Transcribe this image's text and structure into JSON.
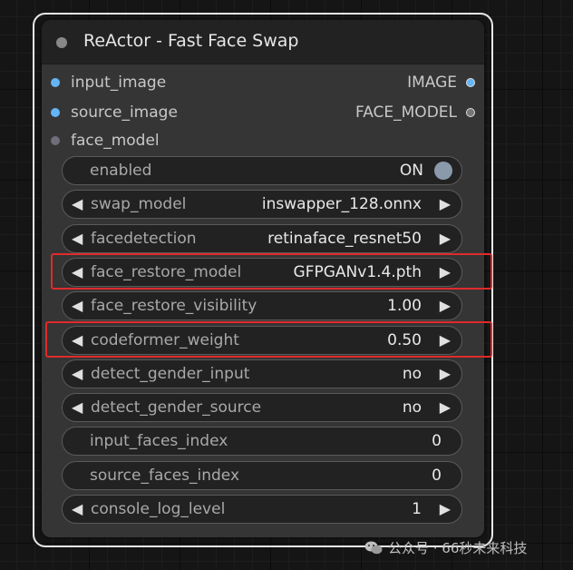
{
  "node": {
    "title": "ReActor - Fast Face Swap",
    "inputs": [
      {
        "label": "input_image",
        "type": "IMAGE"
      },
      {
        "label": "source_image",
        "type": "IMAGE"
      },
      {
        "label": "face_model",
        "type": "FACE_MODEL"
      }
    ],
    "outputs": [
      {
        "label": "IMAGE"
      },
      {
        "label": "FACE_MODEL"
      }
    ],
    "widgets": [
      {
        "name": "enabled",
        "value": "ON",
        "kind": "toggle"
      },
      {
        "name": "swap_model",
        "value": "inswapper_128.onnx",
        "kind": "combo"
      },
      {
        "name": "facedetection",
        "value": "retinaface_resnet50",
        "kind": "combo"
      },
      {
        "name": "face_restore_model",
        "value": "GFPGANv1.4.pth",
        "kind": "combo"
      },
      {
        "name": "face_restore_visibility",
        "value": "1.00",
        "kind": "number"
      },
      {
        "name": "codeformer_weight",
        "value": "0.50",
        "kind": "number"
      },
      {
        "name": "detect_gender_input",
        "value": "no",
        "kind": "combo"
      },
      {
        "name": "detect_gender_source",
        "value": "no",
        "kind": "combo"
      },
      {
        "name": "input_faces_index",
        "value": "0",
        "kind": "text"
      },
      {
        "name": "source_faces_index",
        "value": "0",
        "kind": "text"
      },
      {
        "name": "console_log_level",
        "value": "1",
        "kind": "combo"
      }
    ]
  },
  "icons": {
    "arrow_left": "◀",
    "arrow_right": "▶"
  },
  "colors": {
    "image_slot": "#64b5f6",
    "face_model_slot": "#6f6e7a",
    "highlight": "#e02a2a",
    "node_bg": "#353535",
    "title_bg": "#222222"
  },
  "watermark": "公众号 · 66秒未来科技"
}
